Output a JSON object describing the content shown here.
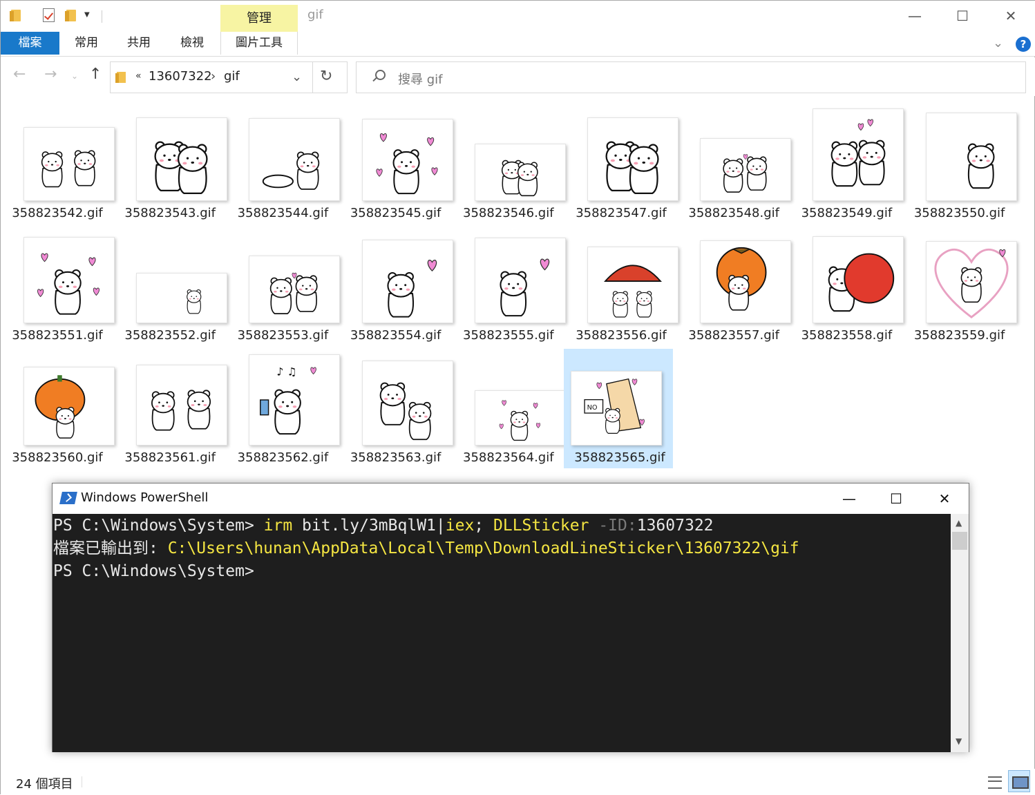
{
  "explorer": {
    "window_title": "gif",
    "contextual_tab": "管理",
    "window_controls": {
      "minimize": "—",
      "maximize": "☐",
      "close": "✕"
    },
    "ribbon_tabs": [
      "檔案",
      "常用",
      "共用",
      "檢視",
      "圖片工具"
    ],
    "address": {
      "overflow": "«",
      "crumbs": [
        "13607322",
        "gif"
      ],
      "separator": "›"
    },
    "search_placeholder": "搜尋 gif",
    "status": {
      "item_count": "24 個項目"
    },
    "files": [
      {
        "name": "358823542.gif",
        "motif": "two-bears"
      },
      {
        "name": "358823543.gif",
        "motif": "hug"
      },
      {
        "name": "358823544.gif",
        "motif": "sleep"
      },
      {
        "name": "358823545.gif",
        "motif": "hearts"
      },
      {
        "name": "358823546.gif",
        "motif": "hug"
      },
      {
        "name": "358823547.gif",
        "motif": "hug"
      },
      {
        "name": "358823548.gif",
        "motif": "kiss"
      },
      {
        "name": "358823549.gif",
        "motif": "blush"
      },
      {
        "name": "358823550.gif",
        "motif": "wave"
      },
      {
        "name": "358823551.gif",
        "motif": "hearts"
      },
      {
        "name": "358823552.gif",
        "motif": "bear"
      },
      {
        "name": "358823553.gif",
        "motif": "kiss"
      },
      {
        "name": "358823554.gif",
        "motif": "heart"
      },
      {
        "name": "358823555.gif",
        "motif": "heart"
      },
      {
        "name": "358823556.gif",
        "motif": "mushroom"
      },
      {
        "name": "358823557.gif",
        "motif": "persimmon"
      },
      {
        "name": "358823558.gif",
        "motif": "apple"
      },
      {
        "name": "358823559.gif",
        "motif": "heart-frame"
      },
      {
        "name": "358823560.gif",
        "motif": "pumpkin"
      },
      {
        "name": "358823561.gif",
        "motif": "two-bears"
      },
      {
        "name": "358823562.gif",
        "motif": "music"
      },
      {
        "name": "358823563.gif",
        "motif": "crying"
      },
      {
        "name": "358823564.gif",
        "motif": "hearts"
      },
      {
        "name": "358823565.gif",
        "motif": "sign",
        "selected": true
      }
    ]
  },
  "powershell": {
    "title": "Windows PowerShell",
    "controls": {
      "minimize": "—",
      "maximize": "☐",
      "close": "✕"
    },
    "lines": [
      [
        {
          "text": "PS C:\\Windows\\System> ",
          "color": "white"
        },
        {
          "text": "irm",
          "color": "yellow"
        },
        {
          "text": " bit.ly/3mBqlW1|",
          "color": "white"
        },
        {
          "text": "iex",
          "color": "yellow"
        },
        {
          "text": "; ",
          "color": "white"
        },
        {
          "text": "DLLSticker",
          "color": "yellow"
        },
        {
          "text": " -ID:",
          "color": "gray"
        },
        {
          "text": "13607322",
          "color": "white"
        }
      ],
      [
        {
          "text": "檔案已輸出到: ",
          "color": "white"
        },
        {
          "text": "C:\\Users\\hunan\\AppData\\Local\\Temp\\DownloadLineSticker\\13607322\\gif",
          "color": "yellow"
        }
      ],
      [
        {
          "text": "PS C:\\Windows\\System>",
          "color": "white"
        }
      ]
    ]
  }
}
